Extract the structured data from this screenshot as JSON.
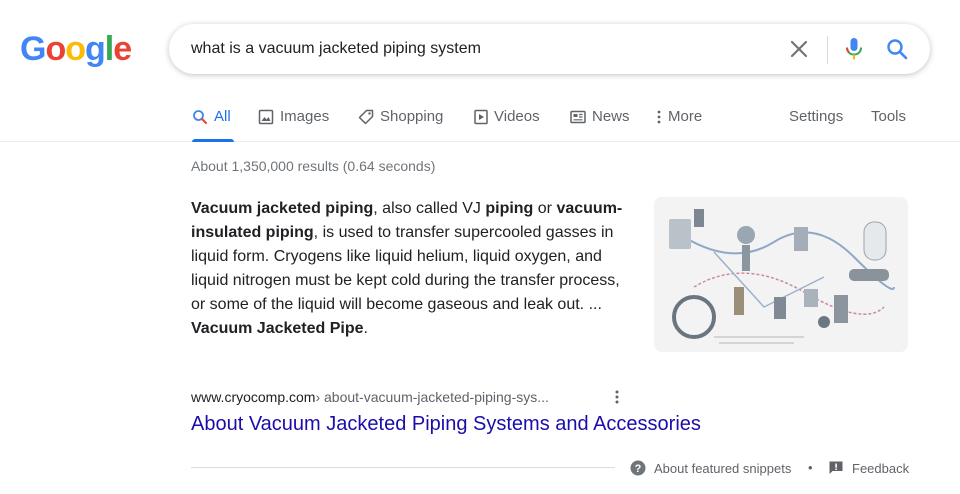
{
  "logo": {
    "letters": [
      "G",
      "o",
      "o",
      "g",
      "l",
      "e"
    ],
    "colors": [
      "#4285F4",
      "#EA4335",
      "#FBBC05",
      "#4285F4",
      "#34A853",
      "#EA4335"
    ]
  },
  "search": {
    "value": "what is a vacuum jacketed piping system"
  },
  "tabs": [
    {
      "label": "All",
      "icon": "search-icon",
      "active": true
    },
    {
      "label": "Images",
      "icon": "image-icon"
    },
    {
      "label": "Shopping",
      "icon": "tag-icon"
    },
    {
      "label": "Videos",
      "icon": "play-icon"
    },
    {
      "label": "News",
      "icon": "newspaper-icon"
    },
    {
      "label": "More",
      "icon": "more-vert-icon"
    }
  ],
  "tools": {
    "settings": "Settings",
    "tools": "Tools"
  },
  "result_stats": "About 1,350,000 results (0.64 seconds)",
  "snippet": {
    "parts": [
      {
        "text": "Vacuum jacketed piping",
        "bold": true
      },
      {
        "text": ", also called VJ ",
        "bold": false
      },
      {
        "text": "piping",
        "bold": true
      },
      {
        "text": " or ",
        "bold": false
      },
      {
        "text": "vacuum-insulated piping",
        "bold": true
      },
      {
        "text": ", is used to transfer supercooled gasses in liquid form. Cryogens like liquid helium, liquid oxygen, and liquid nitrogen must be kept cold during the transfer process, or some of the liquid will become gaseous and leak out. ... ",
        "bold": false
      },
      {
        "text": "Vacuum Jacketed Pipe",
        "bold": true
      },
      {
        "text": ".",
        "bold": false
      }
    ]
  },
  "result": {
    "domain": "www.cryocomp.com",
    "path": " › about-vacuum-jacketed-piping-sys...",
    "title": "About Vacuum Jacketed Piping Systems and Accessories"
  },
  "footer": {
    "about": "About featured snippets",
    "separator": "•",
    "feedback": "Feedback"
  },
  "colors": {
    "link": "#1a0dab",
    "accent": "#1a73e8",
    "muted": "#5f6368"
  }
}
